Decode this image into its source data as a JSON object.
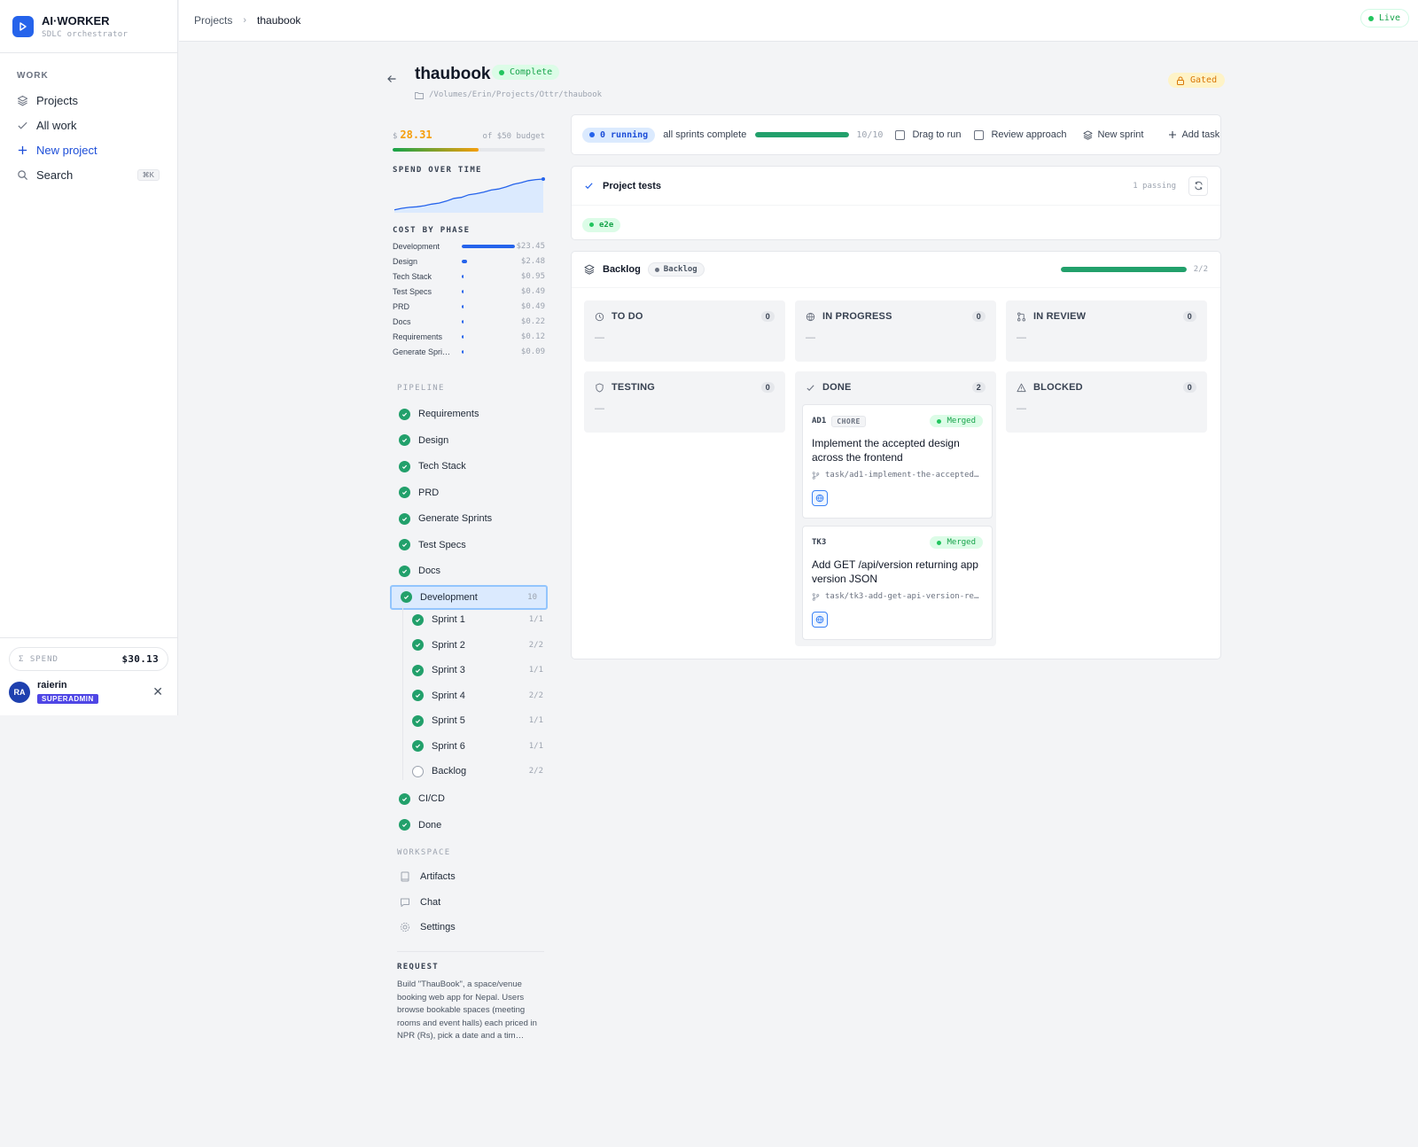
{
  "brand": {
    "name": "AI·WORKER",
    "subtitle": "SDLC orchestrator"
  },
  "nav": {
    "section": "WORK",
    "items": [
      {
        "label": "Projects",
        "icon": "layers-icon"
      },
      {
        "label": "All work",
        "icon": "check-icon"
      },
      {
        "label": "New project",
        "icon": "plus-icon"
      },
      {
        "label": "Search",
        "icon": "search-icon",
        "shortcut": "⌘K"
      }
    ]
  },
  "footer": {
    "spend_label": "Σ SPEND",
    "spend_value": "$30.13",
    "user_initials": "RA",
    "user_name": "raierin",
    "user_role": "SUPERADMIN"
  },
  "topbar": {
    "crumb_root": "Projects",
    "crumb_current": "thaubook",
    "live_label": "Live"
  },
  "project": {
    "name": "thaubook",
    "status": "Complete",
    "path": "/Volumes/Erin/Projects/Ottr/thaubook",
    "gate": "Gated"
  },
  "budget": {
    "currency": "$",
    "spent": "28.31",
    "of_label": "of $50 budget",
    "fraction": 0.566
  },
  "spend_chart_label": "SPEND OVER TIME",
  "chart_data": {
    "type": "area",
    "title": "SPEND OVER TIME",
    "values": [
      0.2,
      0.5,
      0.7,
      0.8,
      1.0,
      1.3,
      1.5,
      1.9,
      2.4,
      2.6,
      3.1,
      3.3,
      3.6,
      4.0,
      4.2,
      4.6,
      5.1,
      5.4,
      5.8,
      6.0,
      6.1
    ]
  },
  "cost_by_phase": {
    "label": "COST BY PHASE",
    "rows": [
      {
        "name": "Development",
        "value": "$23.45",
        "amount": 23.45
      },
      {
        "name": "Design",
        "value": "$2.48",
        "amount": 2.48
      },
      {
        "name": "Tech Stack",
        "value": "$0.95",
        "amount": 0.95
      },
      {
        "name": "Test Specs",
        "value": "$0.49",
        "amount": 0.49
      },
      {
        "name": "PRD",
        "value": "$0.49",
        "amount": 0.49
      },
      {
        "name": "Docs",
        "value": "$0.22",
        "amount": 0.22
      },
      {
        "name": "Requirements",
        "value": "$0.12",
        "amount": 0.12
      },
      {
        "name": "Generate Spri…",
        "value": "$0.09",
        "amount": 0.09
      }
    ]
  },
  "pipeline": {
    "label": "PIPELINE",
    "items": [
      {
        "label": "Requirements"
      },
      {
        "label": "Design"
      },
      {
        "label": "Tech Stack"
      },
      {
        "label": "PRD"
      },
      {
        "label": "Generate Sprints"
      },
      {
        "label": "Test Specs"
      },
      {
        "label": "Docs"
      },
      {
        "label": "Development",
        "count": "10"
      }
    ],
    "sprints": [
      {
        "label": "Sprint 1",
        "count": "1/1",
        "done": true
      },
      {
        "label": "Sprint 2",
        "count": "2/2",
        "done": true
      },
      {
        "label": "Sprint 3",
        "count": "1/1",
        "done": true
      },
      {
        "label": "Sprint 4",
        "count": "2/2",
        "done": true
      },
      {
        "label": "Sprint 5",
        "count": "1/1",
        "done": true
      },
      {
        "label": "Sprint 6",
        "count": "1/1",
        "done": true
      },
      {
        "label": "Backlog",
        "count": "2/2",
        "done": false
      }
    ],
    "after": [
      {
        "label": "CI/CD"
      },
      {
        "label": "Done"
      }
    ]
  },
  "workspace": {
    "label": "WORKSPACE",
    "items": [
      {
        "label": "Artifacts",
        "icon": "book-icon"
      },
      {
        "label": "Chat",
        "icon": "chat-icon"
      },
      {
        "label": "Settings",
        "icon": "gear-icon"
      }
    ]
  },
  "request": {
    "label": "REQUEST",
    "text": "Build \"ThauBook\", a space/venue booking web app for Nepal. Users browse bookable spaces (meeting rooms and event halls) each priced in NPR (Rs), pick a date and a tim…"
  },
  "toolbar": {
    "running": "0 running",
    "status": "all sprints complete",
    "progress": "10/10",
    "progress_fraction": 1.0,
    "drag_label": "Drag to run",
    "review_label": "Review approach",
    "new_sprint_label": "New sprint",
    "add_task_label": "Add task"
  },
  "tests": {
    "title": "Project tests",
    "passing": "1 passing",
    "tag": "e2e"
  },
  "backlog": {
    "title": "Backlog",
    "badge": "Backlog",
    "progress": "2/2",
    "progress_fraction": 1.0,
    "empty_marker": "—",
    "columns": [
      {
        "label": "TO DO",
        "count": "0",
        "icon": "clock-icon"
      },
      {
        "label": "IN PROGRESS",
        "count": "0",
        "icon": "globe-icon"
      },
      {
        "label": "IN REVIEW",
        "count": "0",
        "icon": "merge-icon"
      },
      {
        "label": "TESTING",
        "count": "0",
        "icon": "shield-icon"
      },
      {
        "label": "DONE",
        "count": "2",
        "icon": "check-icon"
      },
      {
        "label": "BLOCKED",
        "count": "0",
        "icon": "warning-icon"
      }
    ],
    "cards": [
      {
        "id": "AD1",
        "chip": "CHORE",
        "status": "Merged",
        "title": "Implement the accepted design across the frontend",
        "branch": "task/ad1-implement-the-accepted…"
      },
      {
        "id": "TK3",
        "status": "Merged",
        "title": "Add GET /api/version returning app version JSON",
        "branch": "task/tk3-add-get-api-version-re…"
      }
    ]
  },
  "colors": {
    "accent": "#2563eb",
    "success": "#22a06b",
    "warning": "#f59e0b"
  }
}
